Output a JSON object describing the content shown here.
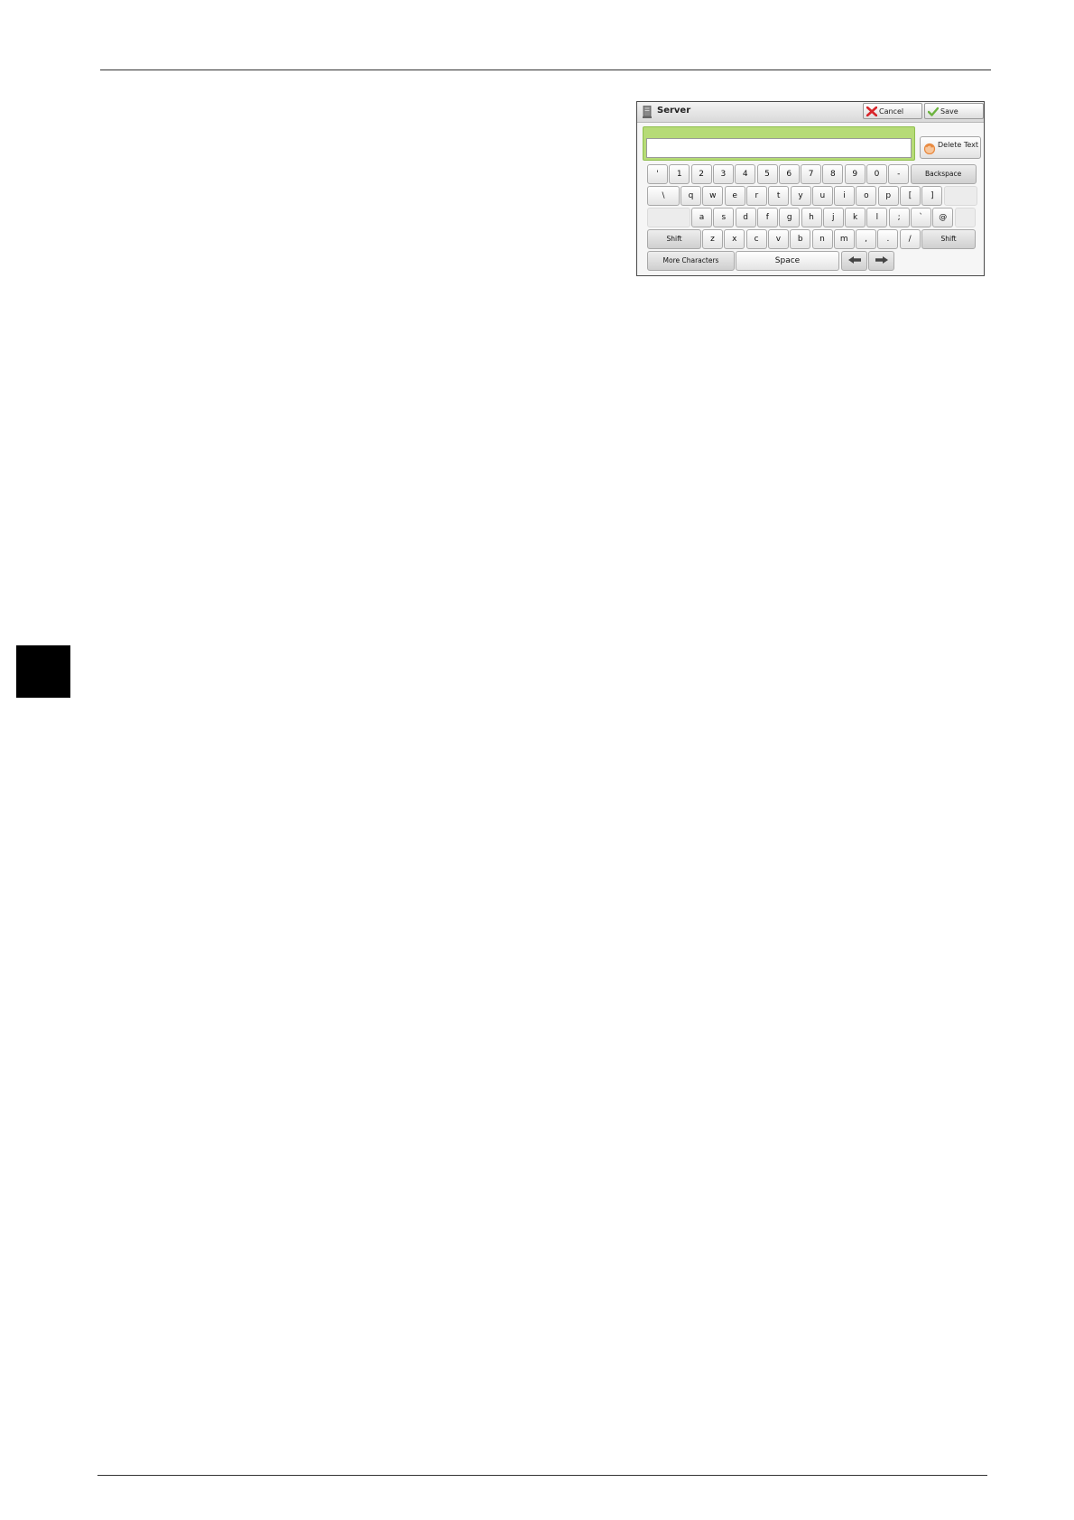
{
  "dialog": {
    "title": "Server",
    "cancel_label": "Cancel",
    "save_label": "Save",
    "text_value": "",
    "delete_text_label": "Delete Text"
  },
  "keyboard": {
    "row1": [
      "'",
      "1",
      "2",
      "3",
      "4",
      "5",
      "6",
      "7",
      "8",
      "9",
      "0",
      "-"
    ],
    "backspace_label": "Backspace",
    "row2": [
      "\\",
      "q",
      "w",
      "e",
      "r",
      "t",
      "y",
      "u",
      "i",
      "o",
      "p",
      "[",
      "]"
    ],
    "row3": [
      "a",
      "s",
      "d",
      "f",
      "g",
      "h",
      "j",
      "k",
      "l",
      ";",
      "`",
      "@"
    ],
    "shift_label": "Shift",
    "row4": [
      "z",
      "x",
      "c",
      "v",
      "b",
      "n",
      "m",
      ",",
      ".",
      "/"
    ],
    "more_characters_label": "More Characters",
    "space_label": "Space"
  },
  "colors": {
    "input_highlight": "#b6db77",
    "cancel_icon": "#d8262b",
    "save_icon": "#6cb33f",
    "delete_icon": "#e8863a"
  }
}
